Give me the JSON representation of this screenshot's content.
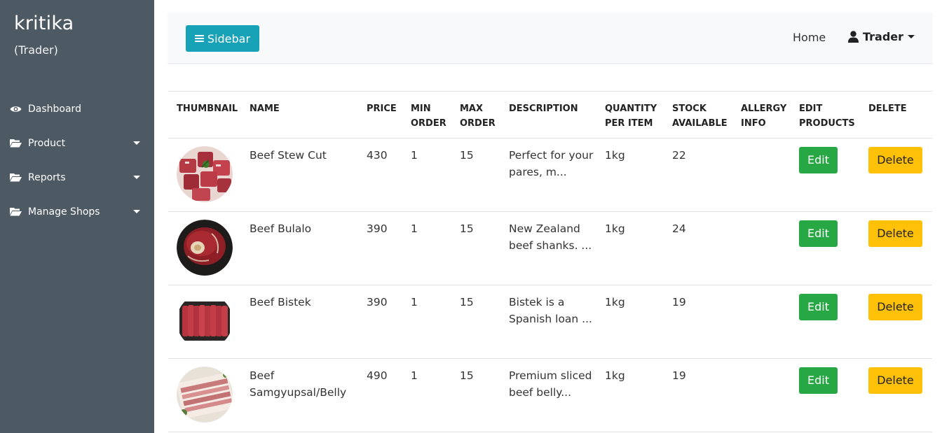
{
  "sidebar": {
    "brand_name": "kritika",
    "brand_role": "(Trader)",
    "items": [
      {
        "label": "Dashboard",
        "icon": "eye-icon",
        "has_caret": false
      },
      {
        "label": "Product",
        "icon": "folder-open-icon",
        "has_caret": true
      },
      {
        "label": "Reports",
        "icon": "folder-open-icon",
        "has_caret": true
      },
      {
        "label": "Manage Shops",
        "icon": "folder-open-icon",
        "has_caret": true
      }
    ],
    "background": "#4e5a63"
  },
  "topbar": {
    "sidebar_button_label": "Sidebar",
    "home_label": "Home",
    "user_label": "Trader"
  },
  "colors": {
    "accent": "#17a2b8",
    "edit": "#28a745",
    "delete": "#ffc107"
  },
  "table": {
    "headers": [
      [
        "THUMBNAIL"
      ],
      [
        "NAME"
      ],
      [
        "PRICE"
      ],
      [
        "MIN",
        "ORDER"
      ],
      [
        "MAX",
        "ORDER"
      ],
      [
        "DESCRIPTION"
      ],
      [
        "QUANTITY",
        "PER ITEM"
      ],
      [
        "STOCK",
        "AVAILABLE"
      ],
      [
        "ALLERGY",
        "INFO"
      ],
      [
        "EDIT",
        "PRODUCTS"
      ],
      [
        "DELETE"
      ]
    ],
    "rows": [
      {
        "name": "Beef Stew Cut",
        "price": "430",
        "min_order": "1",
        "max_order": "15",
        "description": "Perfect for your pares, m...",
        "quantity": "1kg",
        "stock": "22",
        "allergy": "",
        "edit_label": "Edit",
        "delete_label": "Delete",
        "thumbnail": "beef-stew-cubes"
      },
      {
        "name": "Beef Bulalo",
        "price": "390",
        "min_order": "1",
        "max_order": "15",
        "description": "New Zealand beef shanks. ...",
        "quantity": "1kg",
        "stock": "24",
        "allergy": "",
        "edit_label": "Edit",
        "delete_label": "Delete",
        "thumbnail": "beef-shank"
      },
      {
        "name": "Beef Bistek",
        "price": "390",
        "min_order": "1",
        "max_order": "15",
        "description": "Bistek is a Spanish loan ...",
        "quantity": "1kg",
        "stock": "19",
        "allergy": "",
        "edit_label": "Edit",
        "delete_label": "Delete",
        "thumbnail": "beef-slices-tray"
      },
      {
        "name": "Beef Samgyupsal/Belly",
        "price": "490",
        "min_order": "1",
        "max_order": "15",
        "description": "Premium sliced beef belly...",
        "quantity": "1kg",
        "stock": "19",
        "allergy": "",
        "edit_label": "Edit",
        "delete_label": "Delete",
        "thumbnail": "beef-belly-slices"
      }
    ]
  }
}
